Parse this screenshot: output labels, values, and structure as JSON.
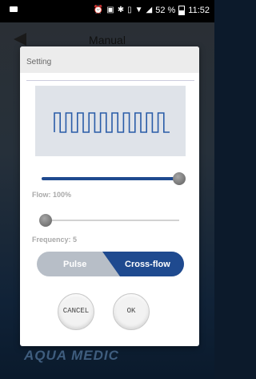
{
  "status_bar": {
    "battery_text": "52 %",
    "time": "11:52",
    "icons": [
      "video-icon",
      "alarm-icon",
      "screenshot-icon",
      "bluetooth-icon",
      "vibrate-icon",
      "wifi-icon",
      "signal-icon",
      "battery-icon"
    ]
  },
  "app_bar": {
    "back_icon": "back-arrow-icon",
    "title": "Manual"
  },
  "dialog": {
    "title": "Setting",
    "waveform": "pulse-square-wave",
    "flow": {
      "label": "Flow: 100%",
      "value_percent": 100
    },
    "frequency": {
      "label": "Frequency: 5",
      "value": 5,
      "slider_fraction": 0.04
    },
    "mode": {
      "options": [
        "Pulse",
        "Cross-flow"
      ],
      "selected": "Cross-flow"
    },
    "buttons": {
      "cancel": "CANCEL",
      "ok": "OK"
    }
  },
  "brand": {
    "logo_text": "AQUA MEDIC"
  },
  "colors": {
    "accent": "#1f4a8f",
    "toggle_inactive": "#b7bec7",
    "wave_panel_bg": "#dfe3e9",
    "wave_stroke": "#2a5ca8"
  }
}
